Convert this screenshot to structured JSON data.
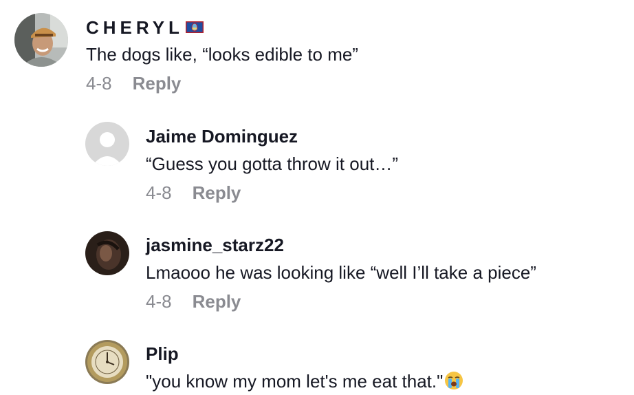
{
  "comments": [
    {
      "username": "CHERYL",
      "flag_icon": "guam-flag-icon",
      "text": "The dogs like, “looks edible to me”",
      "date": "4-8",
      "reply": "Reply",
      "avatar_icon": "user-photo-avatar"
    },
    {
      "username": "Jaime Dominguez",
      "text": "“Guess you gotta throw it out…”",
      "date": "4-8",
      "reply": "Reply",
      "avatar_icon": "default-avatar-icon"
    },
    {
      "username": "jasmine_starz22",
      "text": "Lmaooo he was looking like “well I’ll take a piece”",
      "date": "4-8",
      "reply": "Reply",
      "avatar_icon": "user-photo-avatar"
    },
    {
      "username": "Plip",
      "text": "\"you know my mom let's me eat that.\"",
      "emoji_icon": "loudly-crying-face-icon",
      "avatar_icon": "clock-avatar"
    }
  ],
  "colors": {
    "primary_text": "#161823",
    "secondary_text": "#8a8b91",
    "background": "#ffffff"
  }
}
